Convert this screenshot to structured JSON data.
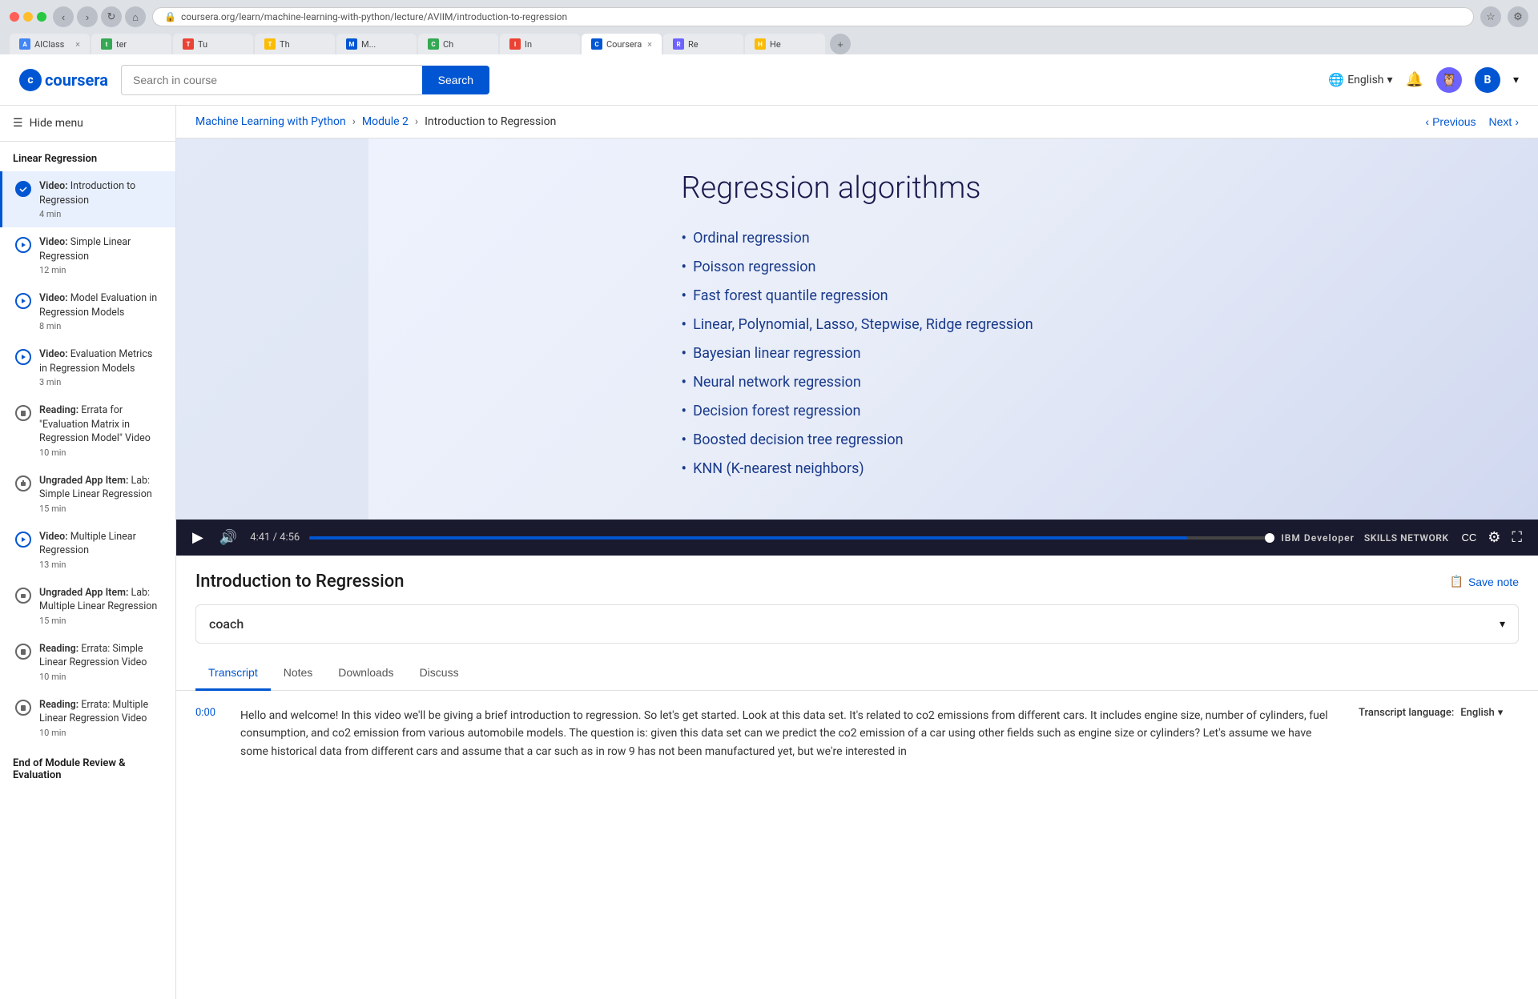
{
  "browser": {
    "url": "coursera.org/learn/machine-learning-with-python/lecture/AVIIM/introduction-to-regression",
    "tabs": [
      {
        "label": "AIClass",
        "color": "#4285f4",
        "active": false
      },
      {
        "label": "ter",
        "color": "#34a853",
        "active": false
      },
      {
        "label": "Tu",
        "color": "#ea4335",
        "active": false
      },
      {
        "label": "Th",
        "color": "#fbbc04",
        "active": false
      },
      {
        "label": "M...",
        "color": "#0056d2",
        "active": false
      },
      {
        "label": "Ch",
        "color": "#34a853",
        "active": false
      },
      {
        "label": "In",
        "color": "#ea4335",
        "active": false
      },
      {
        "label": "Coursera",
        "color": "#0056d2",
        "active": true
      },
      {
        "label": "Re",
        "color": "#6c63ff",
        "active": false
      },
      {
        "label": "He",
        "color": "#fbbc04",
        "active": false
      }
    ]
  },
  "header": {
    "logo_text": "coursera",
    "search_placeholder": "Search in course",
    "search_button": "Search",
    "language": "English",
    "notification_icon": "🔔"
  },
  "sidebar": {
    "hide_menu_label": "Hide menu",
    "section_title": "Linear Regression",
    "items": [
      {
        "type": "Video",
        "title": "Introduction to Regression",
        "duration": "4 min",
        "completed": true,
        "active": true
      },
      {
        "type": "Video",
        "title": "Simple Linear Regression",
        "duration": "12 min",
        "completed": false,
        "active": false
      },
      {
        "type": "Video",
        "title": "Model Evaluation in Regression Models",
        "duration": "8 min",
        "completed": false,
        "active": false
      },
      {
        "type": "Video",
        "title": "Evaluation Metrics in Regression Models",
        "duration": "3 min",
        "completed": false,
        "active": false
      },
      {
        "type": "Reading",
        "title": "Errata for \"Evaluation Matrix in Regression Model\" Video",
        "duration": "10 min",
        "completed": false,
        "active": false
      },
      {
        "type": "Ungraded App Item",
        "title": "Lab: Simple Linear Regression",
        "duration": "15 min",
        "completed": false,
        "active": false
      },
      {
        "type": "Video",
        "title": "Multiple Linear Regression",
        "duration": "13 min",
        "completed": false,
        "active": false
      },
      {
        "type": "Ungraded App Item",
        "title": "Lab: Multiple Linear Regression",
        "duration": "15 min",
        "completed": false,
        "active": false
      },
      {
        "type": "Reading",
        "title": "Errata: Simple Linear Regression Video",
        "duration": "10 min",
        "completed": false,
        "active": false
      },
      {
        "type": "Reading",
        "title": "Errata: Multiple Linear Regression Video",
        "duration": "10 min",
        "completed": false,
        "active": false
      }
    ],
    "end_section_title": "End of Module Review & Evaluation"
  },
  "breadcrumb": {
    "course": "Machine Learning with Python",
    "module": "Module 2",
    "current": "Introduction to Regression"
  },
  "navigation": {
    "previous": "Previous",
    "next": "Next"
  },
  "video": {
    "slide_title": "Regression algorithms",
    "slide_items": [
      "Ordinal regression",
      "Poisson regression",
      "Fast forest quantile regression",
      "Linear, Polynomial, Lasso, Stepwise, Ridge regression",
      "Bayesian linear regression",
      "Neural network regression",
      "Decision forest regression",
      "Boosted decision tree regression",
      "KNN (K-nearest neighbors)"
    ],
    "time_current": "4:41",
    "time_total": "4:56",
    "ibm_watermark": "IBM Developer",
    "skills_watermark": "SKILLS NETWORK",
    "progress_percent": 91.25
  },
  "content": {
    "title": "Introduction to Regression",
    "save_note_label": "Save note",
    "coach_label": "coach",
    "tabs": [
      "Transcript",
      "Notes",
      "Downloads",
      "Discuss"
    ],
    "active_tab": "Transcript",
    "transcript_language_label": "Transcript language:",
    "transcript_language": "English",
    "transcript_entries": [
      {
        "time": "0:00",
        "text": "Hello and welcome! In this video we'll be giving a brief introduction to regression. So let's get started. Look at this data set. It's related to co2 emissions from different cars. It includes engine size, number of cylinders, fuel consumption, and co2 emission from various automobile models. The question is: given this data set can we predict the co2 emission of a car using other fields such as engine size or cylinders? Let's assume we have some historical data from different cars and assume that a car such as in row 9 has not been manufactured yet, but we're interested in"
      }
    ]
  }
}
